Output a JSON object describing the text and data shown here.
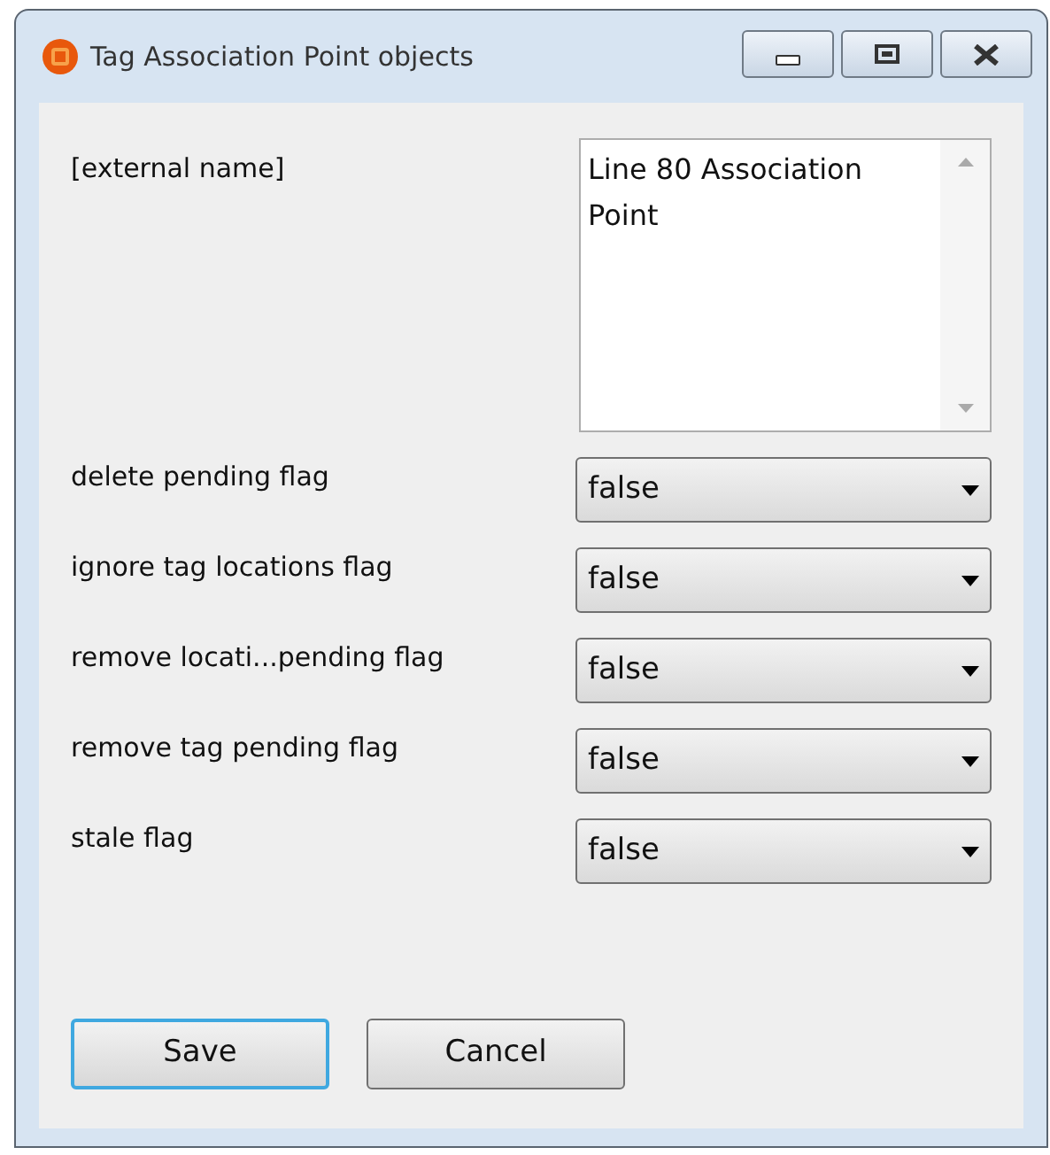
{
  "window": {
    "title": "Tag Association Point objects"
  },
  "text_fields": [
    {
      "label": "[external name]",
      "value": "Line 80 Association Point"
    }
  ],
  "dropdowns": [
    {
      "label": "delete pending flag",
      "value": "false"
    },
    {
      "label": "ignore tag locations flag",
      "value": "false"
    },
    {
      "label": "remove locati...pending flag",
      "value": "false"
    },
    {
      "label": "remove tag pending flag",
      "value": "false"
    },
    {
      "label": "stale flag",
      "value": "false"
    }
  ],
  "buttons": [
    {
      "label": "Save",
      "focused": true
    },
    {
      "label": "Cancel",
      "focused": false
    }
  ]
}
